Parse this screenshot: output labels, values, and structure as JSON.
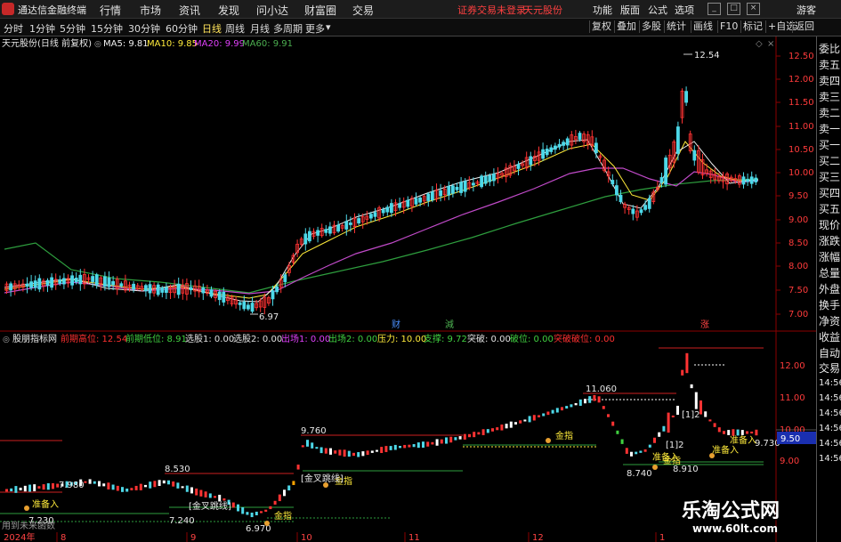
{
  "titlebar": {
    "app_name": "通达信金融终端",
    "menus": [
      "行情",
      "市场",
      "资讯",
      "发现",
      "问小达",
      "财富圈",
      "交易"
    ],
    "warning": "证券交易未登录",
    "stock_name": "天元股份",
    "right_menus": [
      "功能",
      "版面",
      "公式",
      "选项"
    ],
    "guest": "游客"
  },
  "toolbar": {
    "periods": [
      "分时",
      "1分钟",
      "5分钟",
      "15分钟",
      "30分钟",
      "60分钟",
      "日线",
      "周线",
      "月线",
      "多周期",
      "更多"
    ],
    "active_period": "日线",
    "tools": [
      "复权",
      "叠加",
      "多股",
      "统计",
      "画线",
      "F10",
      "标记",
      "+自选",
      "返回"
    ]
  },
  "main_chart": {
    "stock_label": "天元股份(日线 前复权)",
    "ma": [
      {
        "label": "MA5: 9.81",
        "color": "#f0f0f0"
      },
      {
        "label": "MA10: 9.85",
        "color": "#ffeb3b"
      },
      {
        "label": "MA20: 9.99",
        "color": "#e040fb"
      },
      {
        "label": "MA60: 9.91",
        "color": "#4caf50"
      }
    ],
    "high_label": "12.54",
    "low_label": "6.97",
    "markers": [
      {
        "text": "财",
        "color": "#4a90ff"
      },
      {
        "text": "減",
        "color": "#4caf50"
      },
      {
        "text": "涨",
        "color": "#ff4444"
      }
    ],
    "y_axis": [
      "12.50",
      "12.00",
      "11.50",
      "11.00",
      "10.50",
      "10.00",
      "9.50",
      "9.00",
      "8.50",
      "8.00",
      "7.50",
      "7.00"
    ]
  },
  "indicator": {
    "name": "股朋指标网",
    "fields": [
      {
        "label": "前期高位: 12.54",
        "color": "#ff3030"
      },
      {
        "label": "前期低位: 8.91",
        "color": "#40d040"
      },
      {
        "label": "选股1: 0.00",
        "color": "#e0e0e0"
      },
      {
        "label": "选股2: 0.00",
        "color": "#e0e0e0"
      },
      {
        "label": "出场1: 0.00",
        "color": "#e040fb"
      },
      {
        "label": "出场2: 0.00",
        "color": "#40d040"
      },
      {
        "label": "压力: 10.00",
        "color": "#ffeb3b"
      },
      {
        "label": "支撑: 9.72",
        "color": "#40d040"
      },
      {
        "label": "突破: 0.00",
        "color": "#e0e0e0"
      },
      {
        "label": "破位: 0.00",
        "color": "#40d040"
      },
      {
        "label": "突破破位: 0.00",
        "color": "#ff3030"
      }
    ],
    "y_axis": [
      "12.00",
      "11.00",
      "10.00",
      "9.00"
    ],
    "current_price": "9.50",
    "price_labels": [
      "7.980",
      "8.530",
      "7.240",
      "7.230",
      "9.760",
      "11.060",
      "8.740",
      "8.910",
      "9.730",
      "6.970"
    ],
    "signal_labels": {
      "gold": "金指",
      "buy": "准备入",
      "gold_xl": "[金叉跳线]",
      "warn": "[1]2"
    },
    "left_note": "用到未来函数"
  },
  "sidebar": [
    "委比",
    "卖五",
    "卖四",
    "卖三",
    "卖二",
    "卖一",
    "买一",
    "买二",
    "买三",
    "买四",
    "买五",
    "现价",
    "涨跌",
    "涨幅",
    "总量",
    "外盘",
    "换手",
    "净资",
    "收益",
    "自动",
    "交易"
  ],
  "sidebar_times": [
    "14:56",
    "14:56",
    "14:56",
    "14:56",
    "14:56",
    "14:56"
  ],
  "footer": {
    "year": "2024年",
    "months": [
      "8",
      "9",
      "10",
      "11",
      "12",
      "1"
    ]
  },
  "watermark": {
    "title": "乐淘公式网",
    "url": "www.60lt.com"
  }
}
